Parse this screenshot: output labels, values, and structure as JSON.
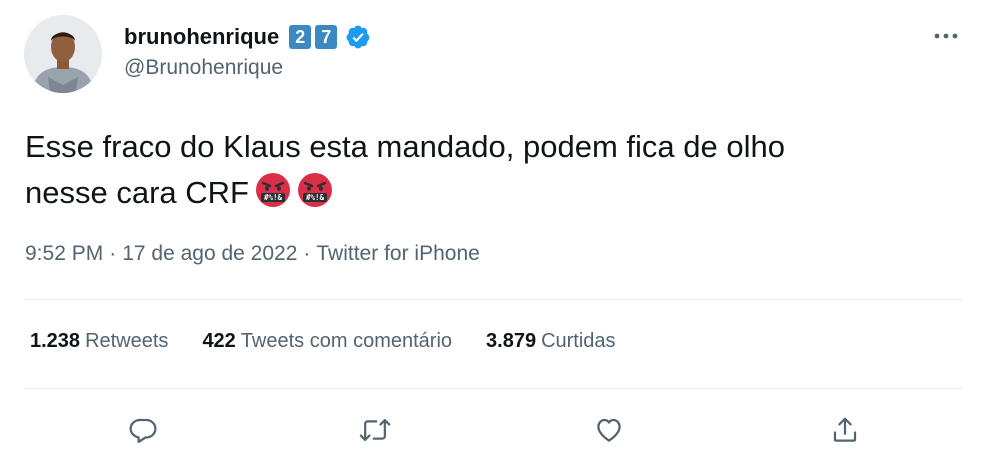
{
  "user": {
    "display_name": "brunohenrique",
    "badge_digits": [
      "2",
      "7"
    ],
    "handle": "@Brunohenrique",
    "verified": true
  },
  "tweet": {
    "lines": [
      "Esse fraco do Klaus esta mandado, podem fica de olho",
      "nesse cara CRF"
    ],
    "emojis": [
      "face-with-symbols-on-mouth",
      "face-with-symbols-on-mouth"
    ],
    "time": "9:52 PM",
    "date": "17 de ago de 2022",
    "separator": "·",
    "source": "Twitter for iPhone"
  },
  "stats": [
    {
      "value": "1.238",
      "label": "Retweets"
    },
    {
      "value": "422",
      "label": "Tweets com comentário"
    },
    {
      "value": "3.879",
      "label": "Curtidas"
    }
  ],
  "icons": {
    "more": "more-horizontal-icon",
    "reply": "reply-icon",
    "retweet": "retweet-icon",
    "like": "heart-icon",
    "share": "share-icon"
  },
  "colors": {
    "text": "#0f1419",
    "secondary": "#536471",
    "verified": "#1d9bf0",
    "badge": "#3b88c3",
    "divider": "#e6ecf0",
    "emoji_face": "#da2f47"
  }
}
